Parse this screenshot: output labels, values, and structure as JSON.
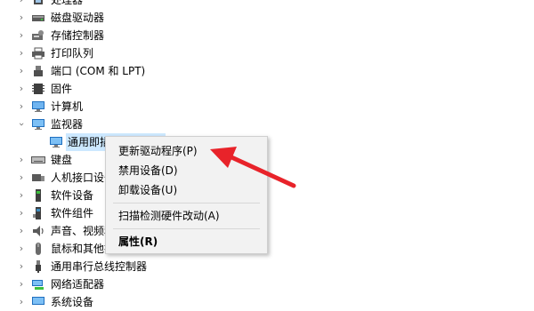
{
  "tree": {
    "items": [
      {
        "label": "处理器",
        "icon": "processor-icon",
        "expanded": false
      },
      {
        "label": "磁盘驱动器",
        "icon": "disk-drive-icon",
        "expanded": false
      },
      {
        "label": "存储控制器",
        "icon": "storage-controller-icon",
        "expanded": false
      },
      {
        "label": "打印队列",
        "icon": "printer-icon",
        "expanded": false
      },
      {
        "label": "端口 (COM 和 LPT)",
        "icon": "port-icon",
        "expanded": false
      },
      {
        "label": "固件",
        "icon": "firmware-icon",
        "expanded": false
      },
      {
        "label": "计算机",
        "icon": "computer-icon",
        "expanded": false
      },
      {
        "label": "监视器",
        "icon": "monitor-icon",
        "expanded": true
      },
      {
        "label": "通用即插即用监视器",
        "icon": "monitor-icon",
        "child": true,
        "selected": true
      },
      {
        "label": "键盘",
        "icon": "keyboard-icon",
        "expanded": false
      },
      {
        "label": "人机接口设备",
        "icon": "hid-icon",
        "expanded": false
      },
      {
        "label": "软件设备",
        "icon": "software-device-icon",
        "expanded": false
      },
      {
        "label": "软件组件",
        "icon": "software-component-icon",
        "expanded": false
      },
      {
        "label": "声音、视频和游戏控制器",
        "icon": "audio-icon",
        "expanded": false
      },
      {
        "label": "鼠标和其他指针设备",
        "icon": "mouse-icon",
        "expanded": false
      },
      {
        "label": "通用串行总线控制器",
        "icon": "usb-icon",
        "expanded": false
      },
      {
        "label": "网络适配器",
        "icon": "network-adapter-icon",
        "expanded": false
      },
      {
        "label": "系统设备",
        "icon": "system-device-icon",
        "expanded": false
      }
    ]
  },
  "context_menu": {
    "items": [
      {
        "label": "更新驱动程序(P)"
      },
      {
        "label": "禁用设备(D)"
      },
      {
        "label": "卸载设备(U)"
      },
      {
        "label": "扫描检测硬件改动(A)"
      },
      {
        "label": "属性(R)",
        "bold": true
      }
    ]
  },
  "colors": {
    "selection": "#cce8ff",
    "arrow": "#e8232a",
    "menu_bg": "#f2f2f2"
  },
  "icons": {
    "collapsed": "chevron-right-icon",
    "expanded": "chevron-down-icon"
  }
}
